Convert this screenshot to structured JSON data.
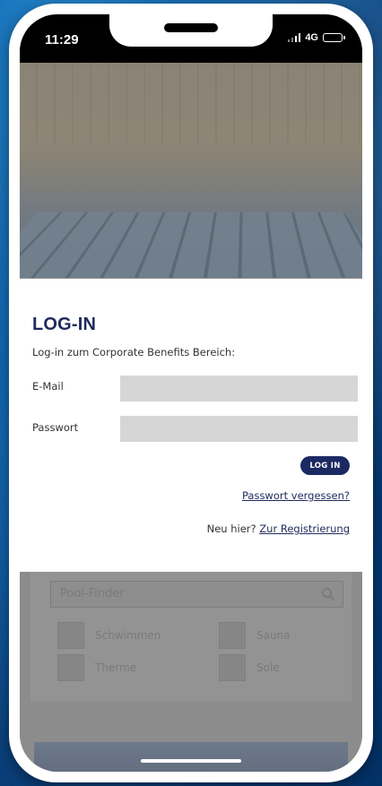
{
  "status_bar": {
    "time": "11:29",
    "network": "4G"
  },
  "login": {
    "title": "LOG-IN",
    "subtitle": "Log-in zum Corporate Benefits Bereich:",
    "email_label": "E-Mail",
    "password_label": "Passwort",
    "email_value": "",
    "password_value": "",
    "login_button": "LOG IN",
    "forgot_password": "Passwort vergessen?",
    "new_here": "Neu hier?",
    "register_link": "Zur Registrierung"
  },
  "background_content": {
    "search_placeholder": "Pool-Finder",
    "filters": [
      "Schwimmen",
      "Sauna",
      "Therme",
      "Sole"
    ]
  },
  "colors": {
    "brand_navy": "#1c2a63",
    "input_gray": "#d6d6d6"
  },
  "icons": {
    "search": "search-icon",
    "battery": "battery-icon",
    "signal": "signal-icon"
  }
}
